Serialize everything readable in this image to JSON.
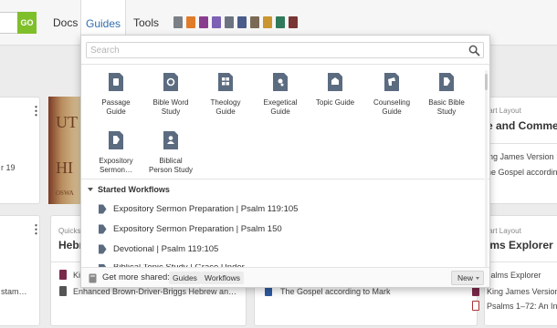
{
  "header": {
    "go_label": "GO",
    "nav": {
      "docs": "Docs",
      "guides": "Guides",
      "tools": "Tools"
    },
    "app_icons": [
      "#7b7f86",
      "#e07b2a",
      "#8a3d8f",
      "#7c61b5",
      "#6c7380",
      "#4a5c8a",
      "#7a6a55",
      "#c9962f",
      "#2f7a5a",
      "#7a3535"
    ]
  },
  "background": {
    "card1": {
      "text_19": "r 19"
    },
    "card4": {
      "layout_label": "tart Layout",
      "title": "e and Commer",
      "line1": "ing James Version",
      "line2": "he Gospel according"
    },
    "card5": {
      "text_stam": "stam…"
    },
    "card6": {
      "label": "Quickst",
      "title": "Hebr",
      "line1": "Ki",
      "line2": "Enhanced Brown-Driver-Briggs Hebrew an…"
    },
    "card7": {
      "line1": "The Gospel according to Mark"
    },
    "card8": {
      "layout_label": "tart Layout",
      "title": "lms Explorer",
      "line1": "salms Explorer",
      "line2": "King James Version",
      "line3": "Psalms 1–72: An Intro"
    },
    "bookcover_text": [
      "UT",
      "HI",
      "OSWA"
    ]
  },
  "panel": {
    "search_placeholder": "Search",
    "guides": [
      {
        "name": "Passage Guide",
        "label": "Passage\nGuide"
      },
      {
        "name": "Bible Word Study",
        "label": "Bible Word\nStudy"
      },
      {
        "name": "Theology Guide",
        "label": "Theology\nGuide"
      },
      {
        "name": "Exegetical Guide",
        "label": "Exegetical\nGuide"
      },
      {
        "name": "Topic Guide",
        "label": "Topic Guide"
      },
      {
        "name": "Counseling Guide",
        "label": "Counseling\nGuide"
      },
      {
        "name": "Basic Bible Study",
        "label": "Basic Bible\nStudy"
      },
      {
        "name": "Expository Sermon",
        "label": "Expository\nSermon…"
      },
      {
        "name": "Biblical Person Study",
        "label": "Biblical\nPerson Study"
      }
    ],
    "section_title": "Started Workflows",
    "workflows": [
      "Expository Sermon Preparation | Psalm 119:105",
      "Expository Sermon Preparation | Psalm 150",
      "Devotional | Psalm 119:105",
      "Biblical Topic Study | Grace Under…"
    ],
    "footer": {
      "text": "Get more shared:",
      "chip_guides": "Guides",
      "chip_workflows": "Workflows",
      "new_label": "New"
    },
    "icon_color": "#5b6b80"
  }
}
